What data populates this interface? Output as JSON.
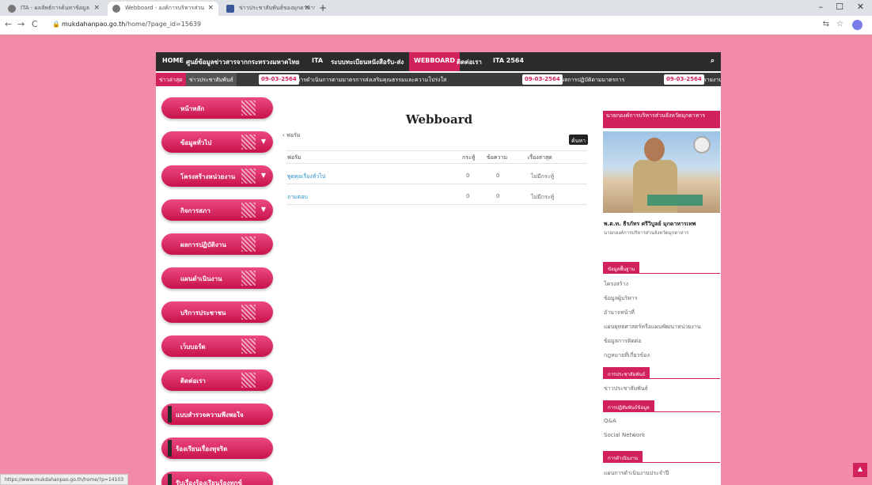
{
  "browser": {
    "tabs": [
      {
        "title": "ITA - ผลลัพธ์การค้นหาข้อมูล",
        "active": false
      },
      {
        "title": "Webboard - องค์การบริหารส่วน",
        "active": true
      },
      {
        "title": "ข่าวประชาสัมพันธ์ของมุกดาหาร",
        "active": false
      }
    ],
    "url_domain": "mukdahanpao.go.th",
    "url_path": "/home/?page_id=15639",
    "status_url": "https://www.mukdahanpao.go.th/home/?p=14103"
  },
  "topnav": {
    "items": [
      "HOME",
      "ศูนย์ข้อมูลข่าวสารจากกระทรวงมหาดไทย",
      "ITA",
      "ระบบทะเบียนหนังสือรับ-ส่ง",
      "WEBBOARD",
      "ติดต่อเรา",
      "ITA 2564"
    ],
    "active": "WEBBOARD"
  },
  "ticker": {
    "tag1": "ข่าวล่าสุด",
    "tag2": "ข่าวประชาสัมพันธ์",
    "date1": "09-03-2564",
    "text1": "การดำเนินการตามมาตรการส่งเสริมคุณธรรมและความโปร่งใส",
    "date2": "09-03-2564",
    "text2": "ผลการปฏิบัติตามมาตรการ",
    "date3": "09-03-2564",
    "text3": "รายงาน"
  },
  "left_menu": [
    {
      "label": "หน้าหลัก",
      "chevron": false
    },
    {
      "label": "ข้อมูลทั่วไป",
      "chevron": true
    },
    {
      "label": "โครงสร้างหน่วยงาน",
      "chevron": true
    },
    {
      "label": "กิจการสภา",
      "chevron": true
    },
    {
      "label": "ผลการปฏิบัติงาน",
      "chevron": false
    },
    {
      "label": "แผนดำเนินงาน",
      "chevron": false
    },
    {
      "label": "บริการประชาชน",
      "chevron": false
    },
    {
      "label": "เว็บบอร์ด",
      "chevron": false
    },
    {
      "label": "ติดต่อเรา",
      "chevron": false
    }
  ],
  "left_menu_bar": [
    {
      "label": "แบบสำรวจความพึงพอใจ"
    },
    {
      "label": "ร้องเรียนเรื่องทุจริต"
    },
    {
      "label": "รับเรื่องร้องเรียนร้องทุกข์"
    }
  ],
  "webboard": {
    "title": "Webboard",
    "breadcrumb": "‹ ฟอรัม",
    "search_label": "ค้นหา",
    "headers": [
      "ฟอรัม",
      "กระทู้",
      "ข้อความ",
      "เรื่องล่าสุด"
    ],
    "rows": [
      {
        "forum": "พูดคุยเรื่องทั่วไป",
        "topics": "0",
        "posts": "0",
        "latest": "ไม่มีกระทู้"
      },
      {
        "forum": "ถามตอบ",
        "topics": "0",
        "posts": "0",
        "latest": "ไม่มีกระทู้"
      }
    ]
  },
  "right": {
    "header": "นายกองค์การบริหารส่วนจังหวัดมุกดาหาร",
    "name": "พ.ต.ท. ธีรภัทร ศรีวิบูลย์ มุกดาหารเทพ",
    "position": "นายกองค์การบริหารส่วนจังหวัดมุกดาหาร",
    "sections": [
      {
        "title": "ข้อมูลพื้นฐาน",
        "links": [
          "โครงสร้าง",
          "ข้อมูลผู้บริหาร",
          "อำนาจหน้าที่",
          "แผนยุทธศาสตร์หรือแผนพัฒนาหน่วยงาน",
          "ข้อมูลการติดต่อ",
          "กฎหมายที่เกี่ยวข้อง"
        ]
      },
      {
        "title": "การประชาสัมพันธ์",
        "links": [
          "ข่าวประชาสัมพันธ์"
        ]
      },
      {
        "title": "การปฏิสัมพันธ์ข้อมูล",
        "links": [
          "Q&A",
          "Social Network"
        ]
      },
      {
        "title": "การดำเนินงาน",
        "links": [
          "แผนการดำเนินงานประจำปี"
        ]
      }
    ]
  },
  "colors": {
    "page_bg": "#f28ba8",
    "accent": "#d2225c",
    "nav": "#2b2b2b"
  }
}
